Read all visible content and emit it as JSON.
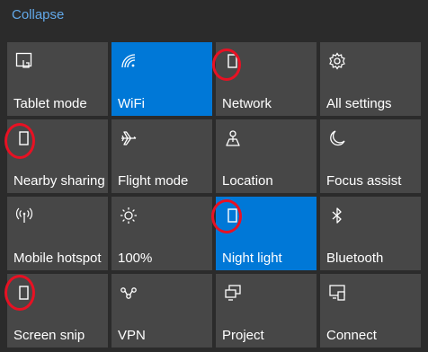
{
  "header": {
    "collapse_label": "Collapse"
  },
  "tiles": [
    {
      "label": "Tablet mode",
      "icon": "tablet-mode-icon",
      "active": false
    },
    {
      "label": "WiFi",
      "icon": "wifi-icon",
      "active": true
    },
    {
      "label": "Network",
      "icon": "placeholder-icon",
      "active": false
    },
    {
      "label": "All settings",
      "icon": "gear-icon",
      "active": false
    },
    {
      "label": "Nearby sharing",
      "icon": "placeholder-icon",
      "active": false
    },
    {
      "label": "Flight mode",
      "icon": "airplane-icon",
      "active": false
    },
    {
      "label": "Location",
      "icon": "location-icon",
      "active": false
    },
    {
      "label": "Focus assist",
      "icon": "moon-icon",
      "active": false
    },
    {
      "label": "Mobile hotspot",
      "icon": "hotspot-icon",
      "active": false
    },
    {
      "label": "100%",
      "icon": "brightness-icon",
      "active": false
    },
    {
      "label": "Night light",
      "icon": "placeholder-icon",
      "active": true
    },
    {
      "label": "Bluetooth",
      "icon": "bluetooth-icon",
      "active": false
    },
    {
      "label": "Screen snip",
      "icon": "placeholder-icon",
      "active": false
    },
    {
      "label": "VPN",
      "icon": "vpn-icon",
      "active": false
    },
    {
      "label": "Project",
      "icon": "project-icon",
      "active": false
    },
    {
      "label": "Connect",
      "icon": "connect-icon",
      "active": false
    }
  ],
  "colors": {
    "tile": "#474747",
    "active": "#0078d7",
    "accent_text": "#62a8e8",
    "annotation": "#e81123"
  }
}
